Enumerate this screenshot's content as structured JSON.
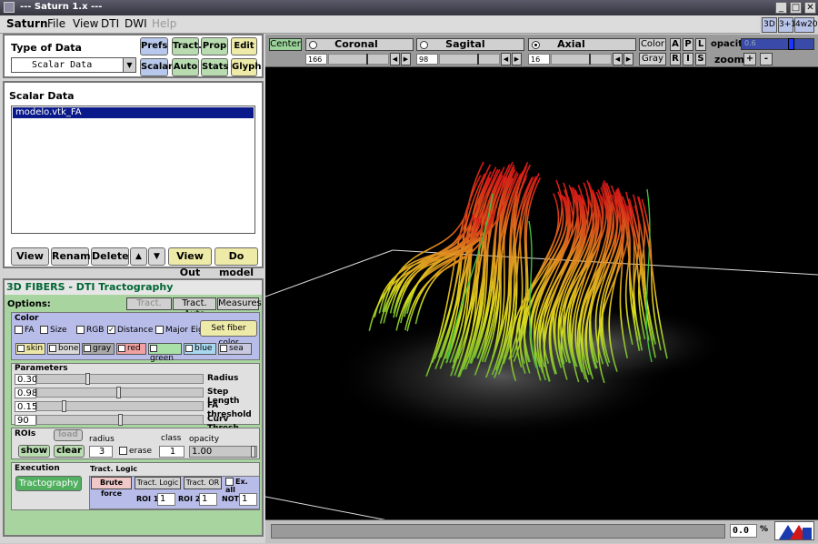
{
  "window": {
    "title": "--- Saturn 1.x ---"
  },
  "menu": [
    "Saturn",
    "File",
    "View",
    "DTI",
    "DWI",
    "Help"
  ],
  "view_mode_buttons": [
    "3D",
    "3+1",
    "4w20"
  ],
  "type_of_data": {
    "label": "Type of Data",
    "selected": "Scalar Data"
  },
  "type_buttons": {
    "prefs": "Prefs",
    "tract": "Tract.",
    "prop": "Prop",
    "edit": "Edit",
    "scalar": "Scalar",
    "auto": "Auto",
    "stats": "Stats",
    "glyph": "Glyph"
  },
  "scalar_data": {
    "label": "Scalar Data",
    "items": [
      "modelo.vtk_FA"
    ]
  },
  "list_buttons": {
    "view": "View",
    "rename": "Rename",
    "delete": "Delete",
    "up": "▲",
    "down": "▼",
    "view_out": "View Out",
    "do_model": "Do model"
  },
  "fibers": {
    "title": "3D FIBERS - DTI Tractography",
    "options_label": "Options:",
    "tabs": [
      "Tract.",
      "Tract. Auto",
      "Measures"
    ]
  },
  "color": {
    "label": "Color",
    "checks": [
      "FA",
      "Size",
      "RGB",
      "Distance",
      "Major Eig"
    ],
    "checked": "Distance",
    "set_fiber_color": "Set fiber color",
    "swatches": [
      {
        "label": "skin",
        "bg": "#eee8a8"
      },
      {
        "label": "bone",
        "bg": "#d8d8d8"
      },
      {
        "label": "gray",
        "bg": "#a8a8a8"
      },
      {
        "label": "red",
        "bg": "#f0a0a0"
      },
      {
        "label": "green",
        "bg": "#a8e0a8"
      },
      {
        "label": "blue",
        "bg": "#a8d8f0"
      },
      {
        "label": "sea",
        "bg": "#c8c8e0"
      }
    ]
  },
  "parameters": {
    "label": "Parameters",
    "rows": [
      {
        "value": "0.30",
        "name": "Radius",
        "pos": 0.3
      },
      {
        "value": "0.98",
        "name": "Step Length",
        "pos": 0.49
      },
      {
        "value": "0.15",
        "name": "FA threshold",
        "pos": 0.15
      },
      {
        "value": "90",
        "name": "Curv Thresh",
        "pos": 0.5
      }
    ]
  },
  "rois": {
    "label": "ROIs",
    "load": "load",
    "show": "show",
    "clear": "clear",
    "radius_label": "radius",
    "radius": "3",
    "erase": "erase",
    "class_label": "class",
    "class_value": "1",
    "opacity_label": "opacity",
    "opacity": "1.00"
  },
  "execution": {
    "label": "Execution",
    "tractography": "Tractography",
    "logic_label": "Tract. Logic",
    "brute_force": "Brute force",
    "tract_logic": "Tract. Logic",
    "tract_or": "Tract. OR",
    "ex_all": "Ex. all",
    "roi1_label": "ROI 1",
    "roi1": "1",
    "roi2_label": "ROI 2",
    "roi2": "1",
    "not_label": "NOT",
    "not_value": "1"
  },
  "viewer": {
    "center": "Center",
    "planes": [
      {
        "name": "Coronal",
        "value": "166",
        "selected": false
      },
      {
        "name": "Sagital",
        "value": "98",
        "selected": false
      },
      {
        "name": "Axial",
        "value": "16",
        "selected": true
      }
    ],
    "color": "Color",
    "gray": "Gray",
    "orient": [
      "A",
      "P",
      "L",
      "R",
      "I",
      "S"
    ],
    "opacity_label": "opacity",
    "opacity_value": "0.6",
    "zoom_label": "zoom",
    "zoom_in": "+",
    "zoom_out": "-",
    "status_value": "0.0",
    "status_unit": "%"
  },
  "colors": {
    "fiber_red": "#e01818",
    "fiber_yellow": "#e8e820",
    "fiber_green": "#40c040",
    "selection": "#0a1a8a"
  }
}
